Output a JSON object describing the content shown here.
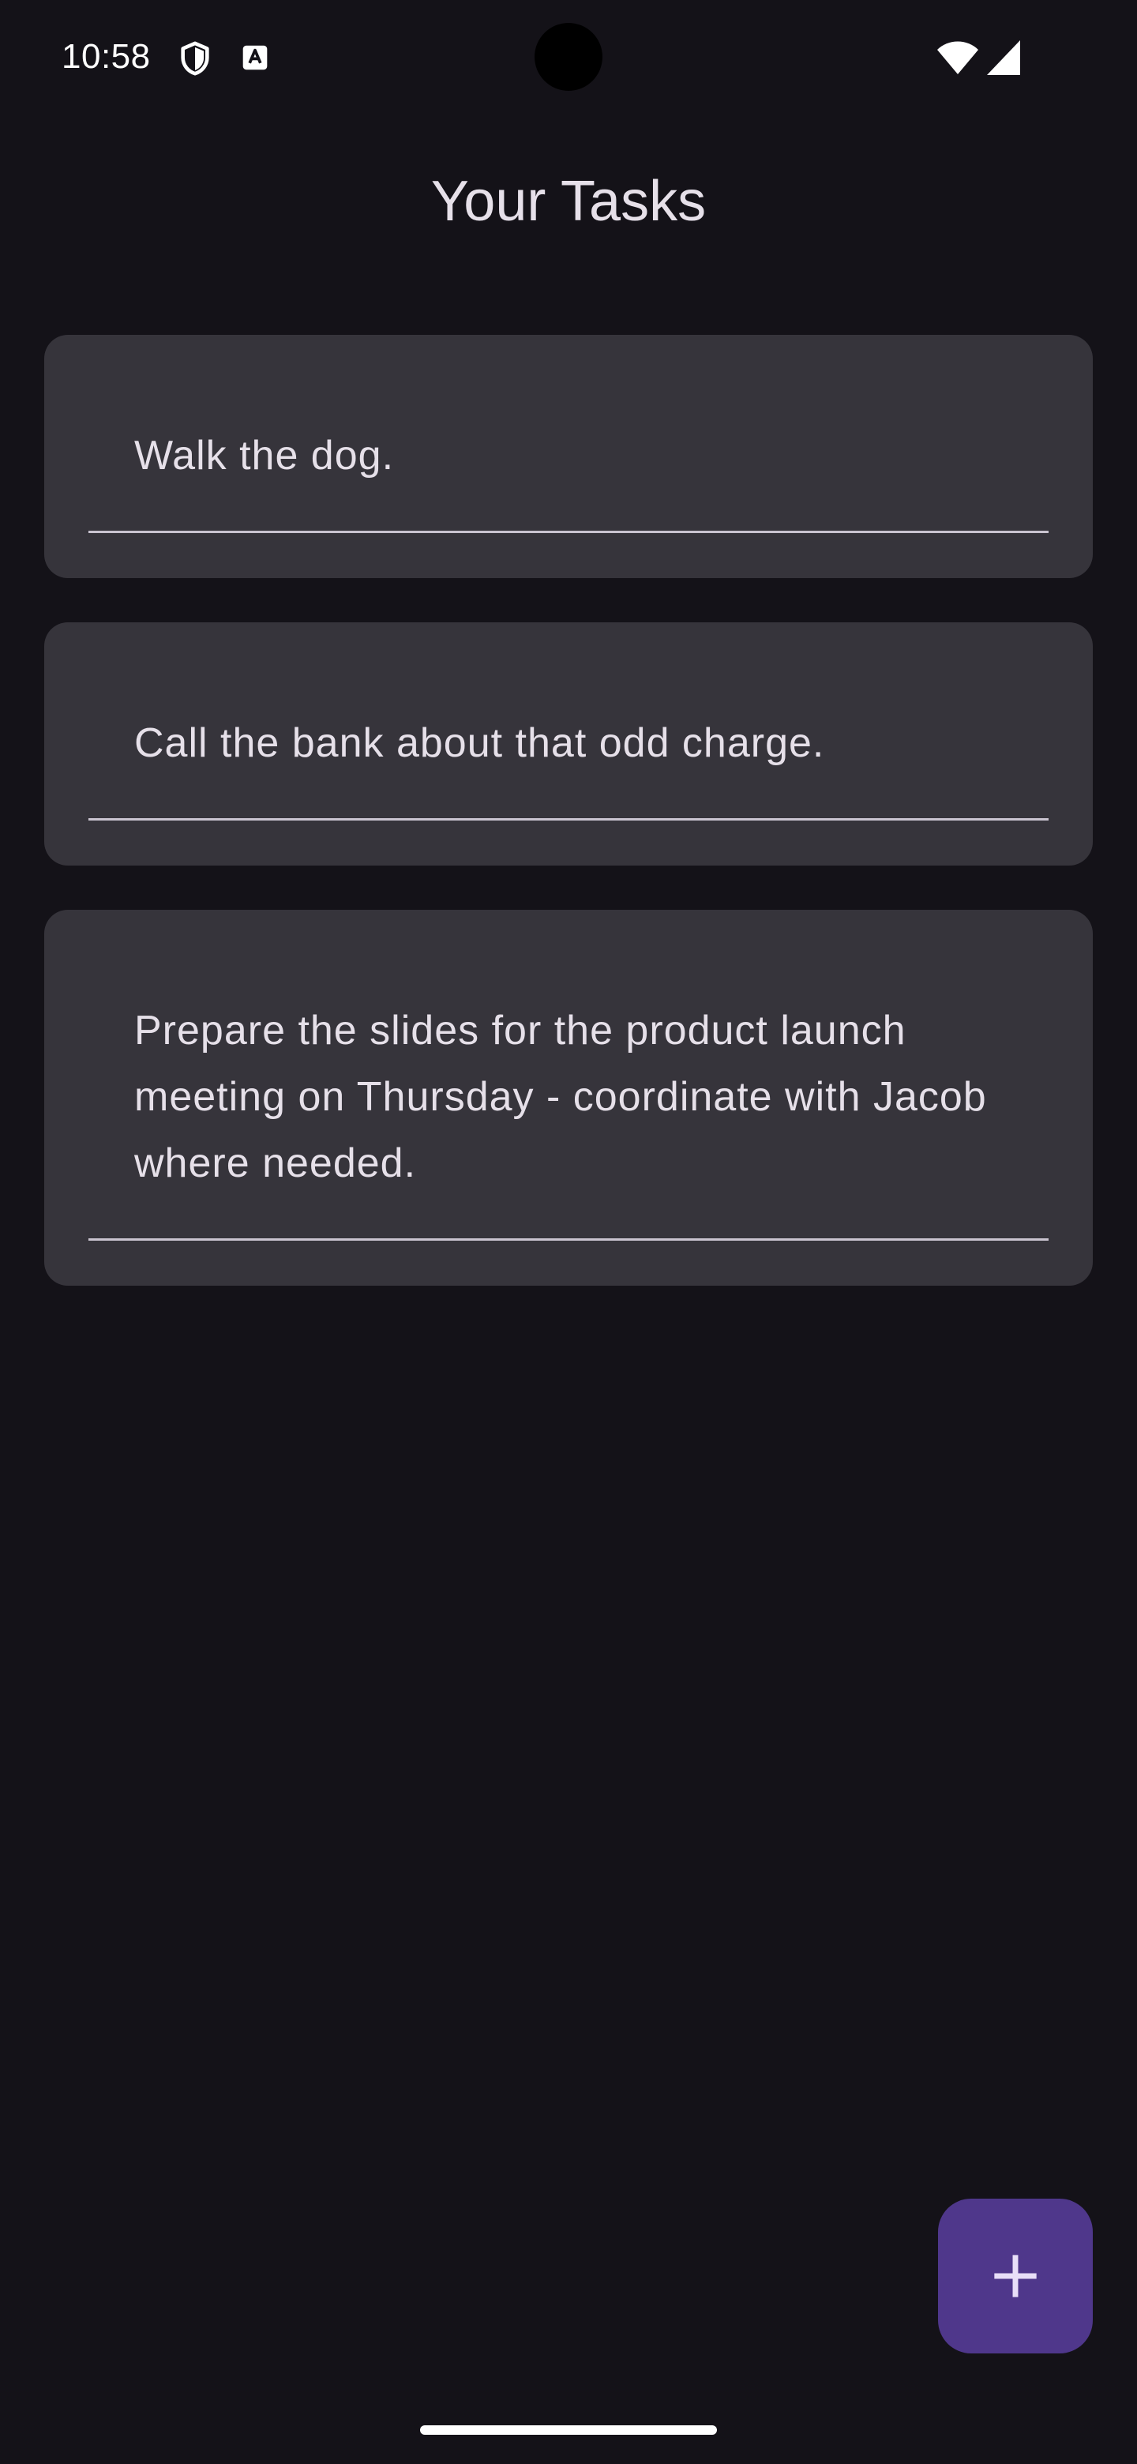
{
  "status_bar": {
    "time": "10:58",
    "icons": [
      "shield-icon",
      "a-icon",
      "wifi-icon",
      "signal-icon"
    ]
  },
  "page": {
    "title": "Your Tasks"
  },
  "tasks": [
    {
      "text": "Walk the dog."
    },
    {
      "text": "Call the bank about that odd charge."
    },
    {
      "text": "Prepare the slides for the product launch meeting on Thursday - coordinate with Jacob where needed."
    }
  ],
  "fab": {
    "icon": "plus-icon",
    "color": "#4f378b"
  },
  "colors": {
    "background": "#141218",
    "card": "#36343b",
    "text": "#e6e0e9",
    "accent": "#4f378b"
  }
}
